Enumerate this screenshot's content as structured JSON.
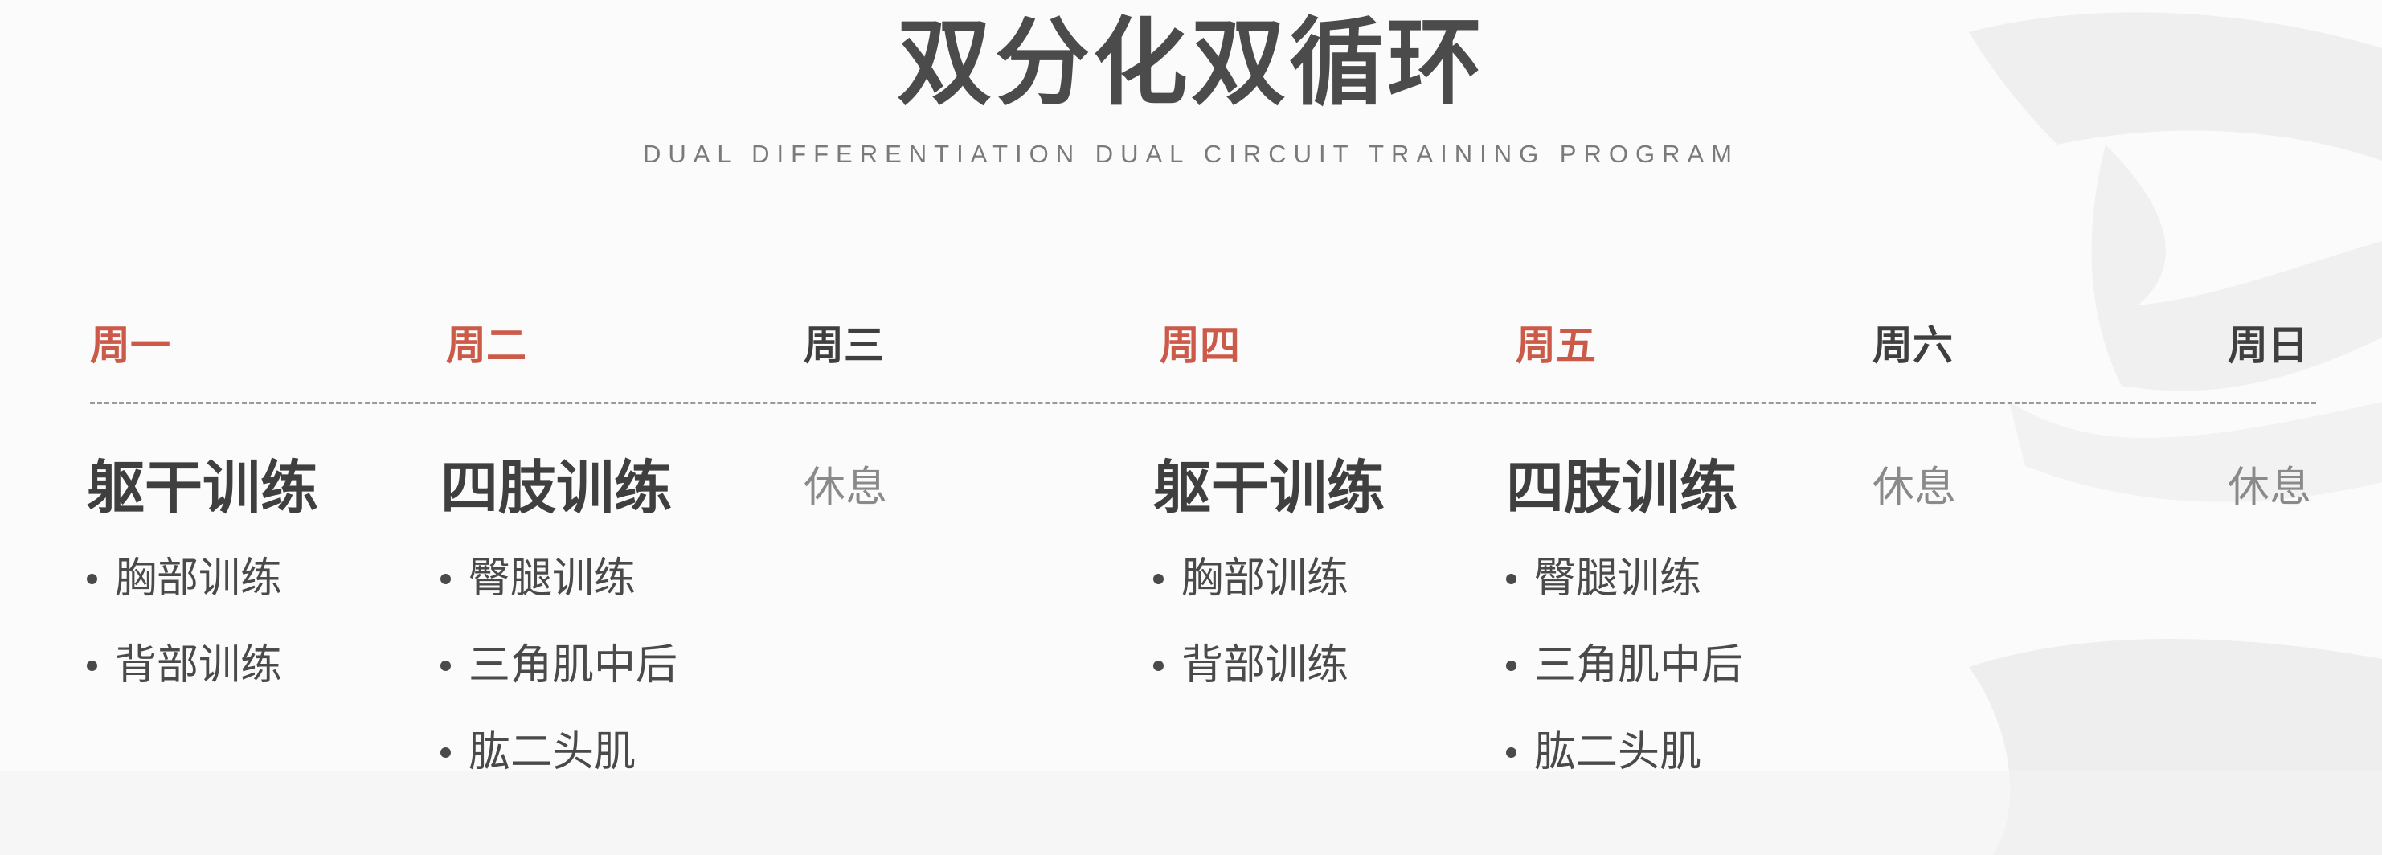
{
  "header": {
    "title": "双分化双循环",
    "subtitle": "DUAL DIFFERENTIATION DUAL CIRCUIT TRAINING PROGRAM"
  },
  "colors": {
    "accent": "#cc5a49",
    "rest_day": "#3f3f3f",
    "text": "#4a4a4a",
    "muted": "#8a8a8a"
  },
  "days": [
    {
      "label": "周一",
      "type": "workout",
      "heading": "躯干训练",
      "items": [
        "胸部训练",
        "背部训练"
      ]
    },
    {
      "label": "周二",
      "type": "workout",
      "heading": "四肢训练",
      "items": [
        "臀腿训练",
        "三角肌中后",
        "肱二头肌"
      ]
    },
    {
      "label": "周三",
      "type": "rest",
      "heading": "休息",
      "items": []
    },
    {
      "label": "周四",
      "type": "workout",
      "heading": "躯干训练",
      "items": [
        "胸部训练",
        "背部训练"
      ]
    },
    {
      "label": "周五",
      "type": "workout",
      "heading": "四肢训练",
      "items": [
        "臀腿训练",
        "三角肌中后",
        "肱二头肌"
      ]
    },
    {
      "label": "周六",
      "type": "rest",
      "heading": "休息",
      "items": []
    },
    {
      "label": "周日",
      "type": "rest",
      "heading": "休息",
      "items": []
    }
  ]
}
